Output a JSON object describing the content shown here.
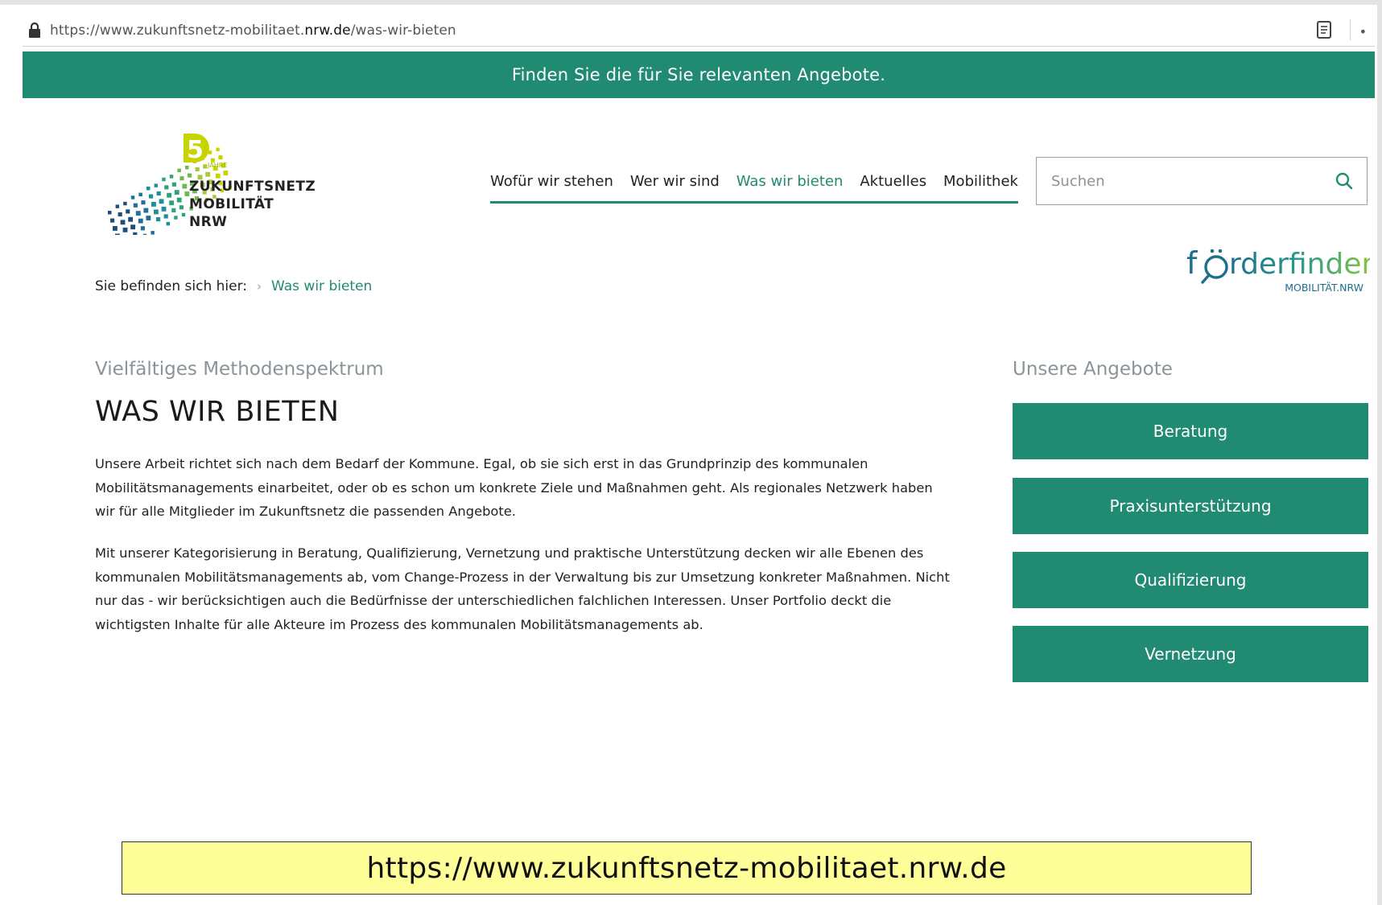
{
  "browser": {
    "url_prefix": "https://www.zukunftsnetz-mobilitaet.",
    "url_domain": "nrw.de",
    "url_path": "/was-wir-bieten"
  },
  "banner": {
    "text": "Finden Sie die für Sie relevanten Angebote."
  },
  "logo": {
    "badge": "JAHRE",
    "number": "5",
    "line1": "ZUKUNFTSNETZ",
    "line2": "MOBILITÄT",
    "line3": "NRW"
  },
  "nav": {
    "items": [
      {
        "label": "Wofür wir stehen",
        "active": false
      },
      {
        "label": "Wer wir sind",
        "active": false
      },
      {
        "label": "Was wir bieten",
        "active": true
      },
      {
        "label": "Aktuelles",
        "active": false
      },
      {
        "label": "Mobilithek",
        "active": false
      }
    ]
  },
  "search": {
    "placeholder": "Suchen"
  },
  "foerderfinder": {
    "wordmark_a": "f",
    "wordmark_b": "rderfinder",
    "sub": "MOBILITÄT.NRW"
  },
  "breadcrumb": {
    "label": "Sie befinden sich hier:",
    "chevron": "›",
    "current": "Was wir bieten"
  },
  "main": {
    "eyebrow": "Vielfältiges Methodenspektrum",
    "title": "WAS WIR BIETEN",
    "paragraph1": "Unsere Arbeit richtet sich nach dem Bedarf der Kommune. Egal, ob sie sich erst in das Grundprinzip des kommunalen Mobilitätsmanagements einarbeitet, oder ob es schon um konkrete Ziele und Maßnahmen geht. Als regionales Netzwerk haben wir für alle Mitglieder im Zukunftsnetz die passenden Angebote.",
    "paragraph2": "Mit unserer Kategorisierung in Beratung, Qualifizierung, Vernetzung und praktische Unterstützung decken wir alle Ebenen des kommunalen Mobilitätsmanagements ab, vom Change-Prozess in der Verwaltung bis zur Umsetzung konkreter Maßnahmen. Nicht nur das - wir berücksichtigen auch die Bedürfnisse der unterschiedlichen falchlichen Interessen. Unser Portfolio deckt die wichtigsten Inhalte für alle Akteure im Prozess des kommunalen Mobilitätsmanagements ab."
  },
  "sidebar": {
    "title": "Unsere Angebote",
    "offers": [
      "Beratung",
      "Praxisunterstützung",
      "Qualifizierung",
      "Vernetzung"
    ]
  },
  "caption": {
    "text": "https://www.zukunftsnetz-mobilitaet.nrw.de"
  },
  "colors": {
    "brand_green": "#218a72",
    "caption_bg": "#ffff99",
    "muted_text": "#8a9499"
  }
}
